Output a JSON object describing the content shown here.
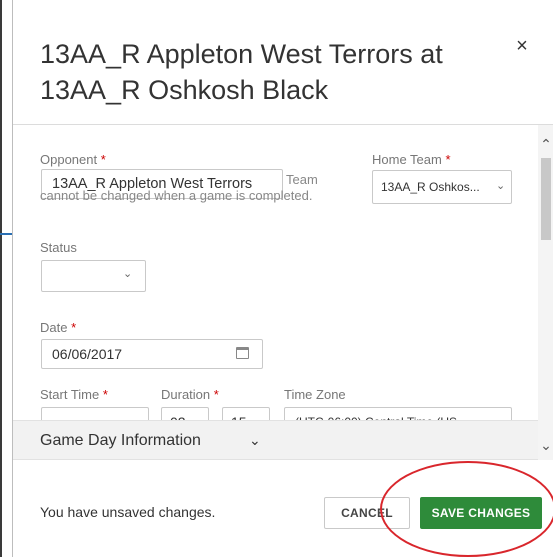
{
  "modal": {
    "title": "13AA_R Appleton West Terrors at 13AA_R Oshkosh Black",
    "close_glyph": "×"
  },
  "form": {
    "opponent": {
      "label": "Opponent",
      "required_mark": "*",
      "value": "13AA_R Appleton West Terrors",
      "help_text": "Team cannot be changed when a game is completed."
    },
    "home_team": {
      "label": "Home Team",
      "required_mark": "*",
      "value": "13AA_R Oshkos..."
    },
    "status": {
      "label": "Status",
      "value": ""
    },
    "date": {
      "label": "Date",
      "required_mark": "*",
      "value": "06/06/2017"
    },
    "start_time": {
      "label": "Start Time",
      "required_mark": "*",
      "value": ""
    },
    "duration": {
      "label": "Duration",
      "required_mark": "*",
      "hours": "02",
      "minutes": "15"
    },
    "time_zone": {
      "label": "Time Zone",
      "value": "(UTC-06:00) Central Time (US..."
    }
  },
  "section": {
    "title": "Game Day Information"
  },
  "footer": {
    "message": "You have unsaved changes.",
    "cancel_label": "CANCEL",
    "save_label": "SAVE CHANGES"
  },
  "colors": {
    "save_button": "#2e8b3a",
    "annotation": "#d9262c",
    "required": "#cc0000"
  }
}
